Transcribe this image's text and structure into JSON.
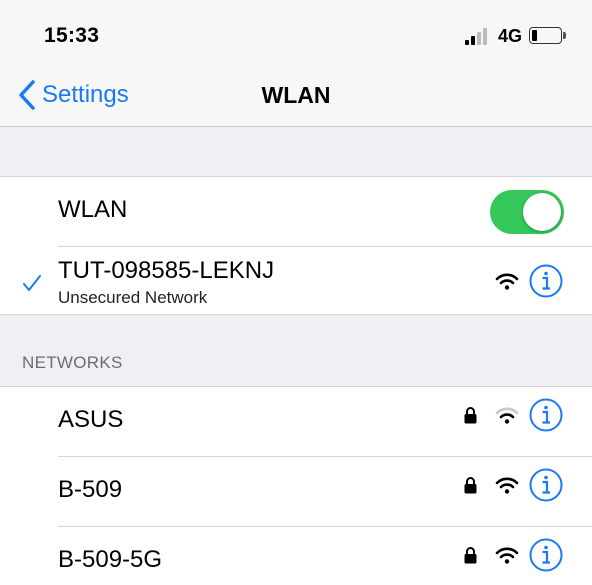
{
  "status_bar": {
    "time": "15:33",
    "network_type": "4G",
    "battery_level": 0.2
  },
  "nav": {
    "back_label": "Settings",
    "title": "WLAN"
  },
  "wlan_toggle": {
    "label": "WLAN",
    "on": true
  },
  "connected": {
    "name": "TUT-098585-LEKNJ",
    "subtitle": "Unsecured Network",
    "icons": [
      "checkmark-icon",
      "wifi-icon",
      "info-icon"
    ]
  },
  "networks_header": "NETWORKS",
  "networks": [
    {
      "name": "ASUS",
      "secured": true,
      "signal": "weak"
    },
    {
      "name": "B-509",
      "secured": true,
      "signal": "full"
    },
    {
      "name": "B-509-5G",
      "secured": true,
      "signal": "full"
    }
  ],
  "colors": {
    "accent": "#1a79f6",
    "toggle_on": "#34c759",
    "background": "#efeff4"
  }
}
